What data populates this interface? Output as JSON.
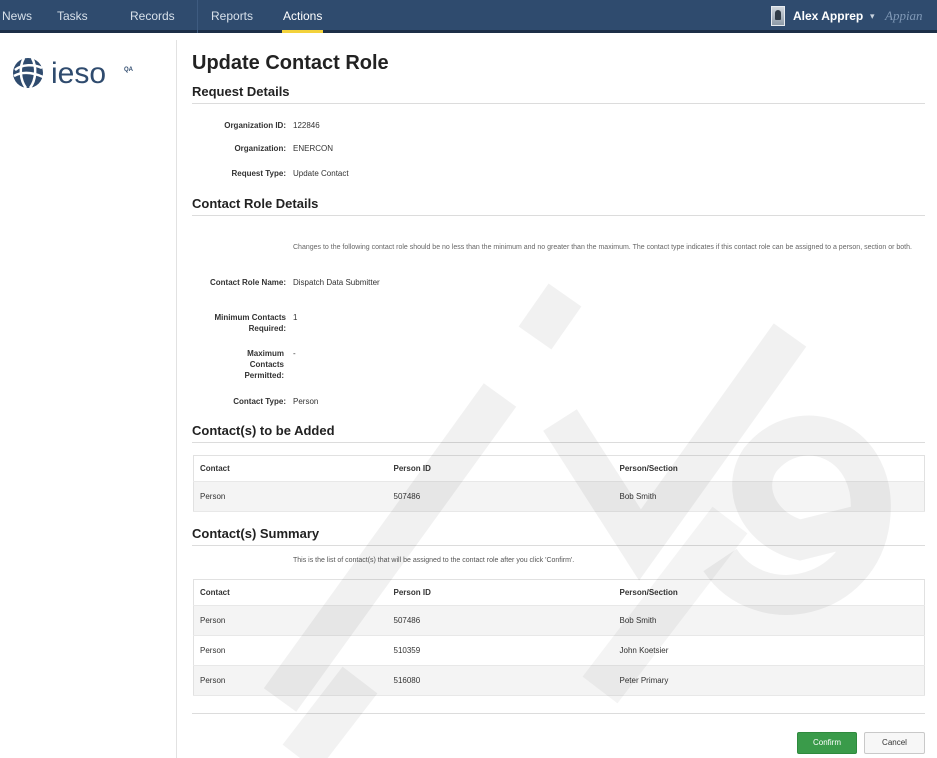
{
  "nav": {
    "tabs": [
      {
        "label": "News"
      },
      {
        "label": "Tasks"
      },
      {
        "label": "Records"
      },
      {
        "label": "Reports"
      },
      {
        "label": "Actions",
        "active": true
      }
    ],
    "user_name": "Alex Apprep",
    "user_caret": "▾",
    "brand": "Appian"
  },
  "logo": {
    "text": "ieso",
    "badge": "QA"
  },
  "page_title": "Update Contact Role",
  "request_details": {
    "title": "Request Details",
    "org_id_label": "Organization ID:",
    "org_id": "122846",
    "org_label": "Organization:",
    "org": "ENERCON",
    "req_type_label": "Request Type:",
    "req_type": "Update Contact"
  },
  "role_details": {
    "title": "Contact Role Details",
    "note": "Changes to the following contact role should be no less than the minimum and no greater than the maximum. The contact type indicates if this contact role can be assigned to a person, section or both.",
    "name_label": "Contact Role Name:",
    "name": "Dispatch Data Submitter",
    "min_label": "Minimum Contacts Required:",
    "min": "1",
    "max_label": "Maximum Contacts Permitted:",
    "max": "-",
    "type_label": "Contact Type:",
    "type": "Person"
  },
  "added": {
    "title": "Contact(s) to be Added",
    "columns": [
      "Contact",
      "Person ID",
      "Person/Section"
    ],
    "rows": [
      [
        "Person",
        "507486",
        "Bob Smith"
      ]
    ]
  },
  "summary": {
    "title": "Contact(s) Summary",
    "note": "This is the list of contact(s) that will be assigned to the contact role after you click 'Confirm'.",
    "columns": [
      "Contact",
      "Person ID",
      "Person/Section"
    ],
    "rows": [
      [
        "Person",
        "507486",
        "Bob Smith"
      ],
      [
        "Person",
        "510359",
        "John Koetsier"
      ],
      [
        "Person",
        "516080",
        "Peter Primary"
      ]
    ]
  },
  "buttons": {
    "confirm": "Confirm",
    "cancel": "Cancel"
  },
  "colors": {
    "nav_bg": "#2f4b6e",
    "active_tab": "#f3d23b",
    "confirm": "#3a9b4a"
  },
  "icons": {
    "logo": "globe-icon",
    "avatar": "user-avatar-icon"
  }
}
